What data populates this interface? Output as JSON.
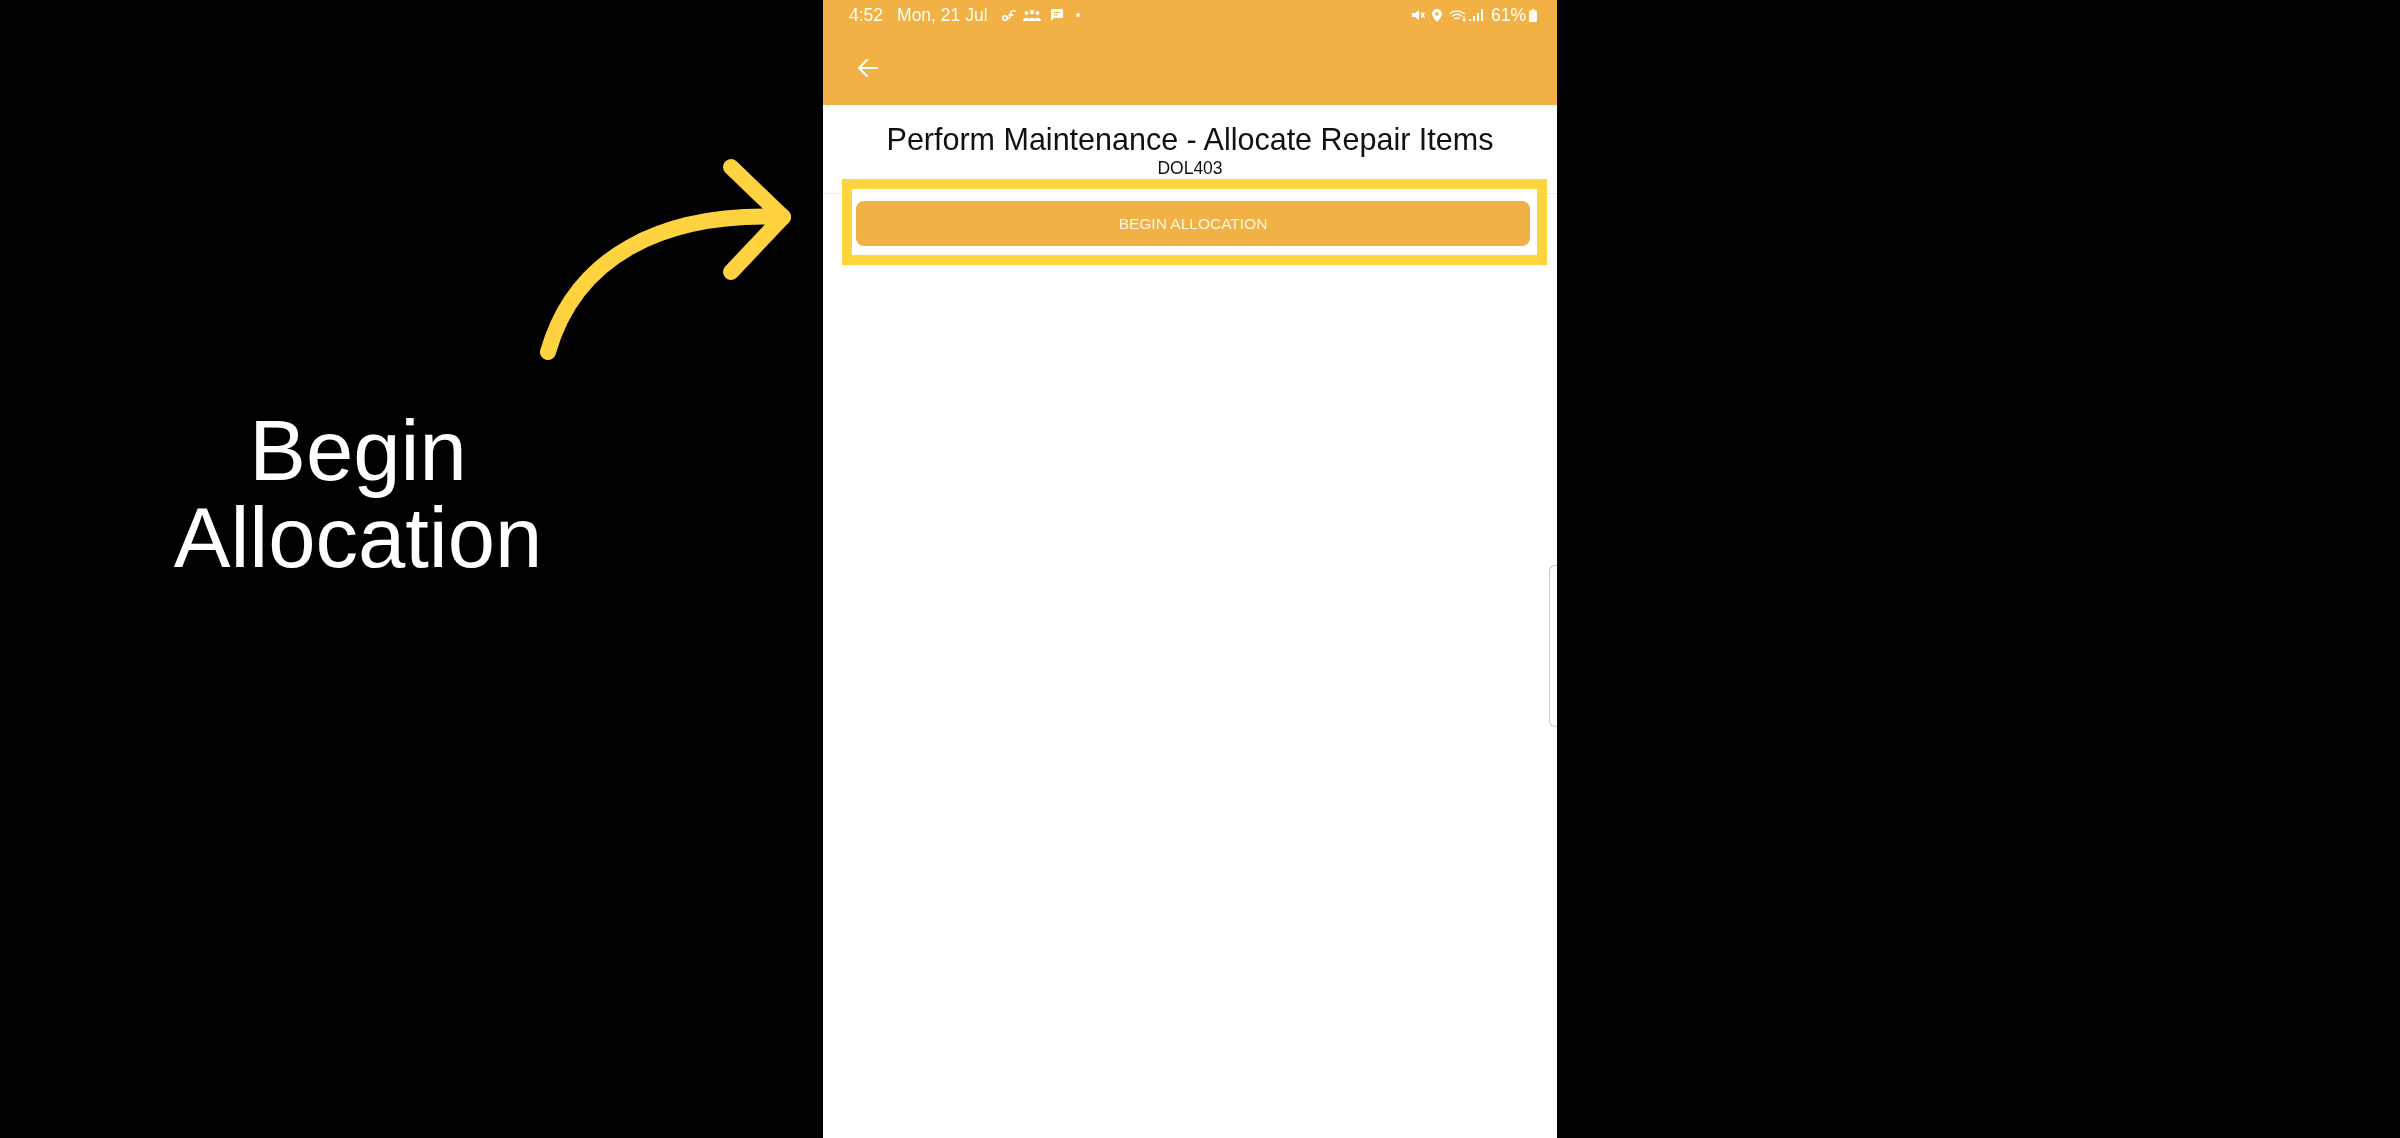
{
  "annotation": {
    "caption": "Begin Allocation"
  },
  "status_bar": {
    "time": "4:52",
    "date": "Mon, 21 Jul",
    "battery": "61%"
  },
  "screen": {
    "title": "Perform Maintenance - Allocate Repair Items",
    "subtitle": "DOL403",
    "button": "BEGIN ALLOCATION"
  }
}
